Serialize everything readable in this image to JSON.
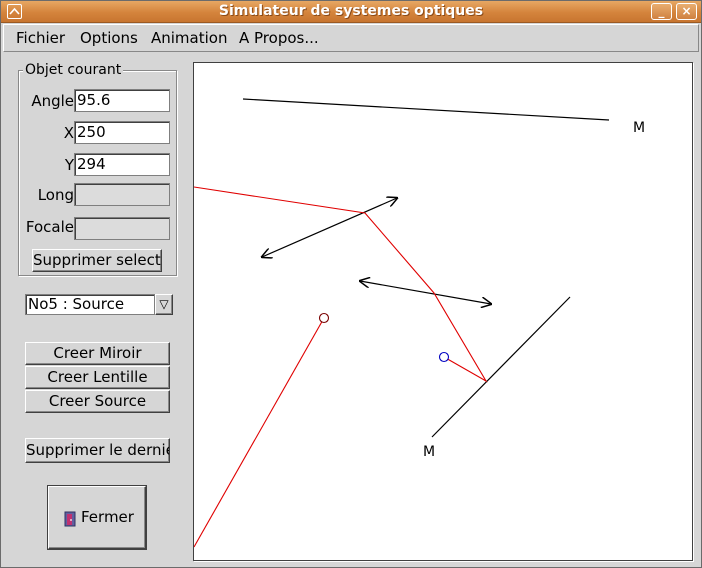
{
  "window": {
    "title": "Simulateur de systemes optiques",
    "minimize_glyph": "_",
    "close_glyph": "×"
  },
  "menu": {
    "items": [
      "Fichier",
      "Options",
      "Animation",
      "A Propos..."
    ]
  },
  "object_panel": {
    "group_label": "Objet courant",
    "fields": [
      {
        "label": "Angle",
        "value": "95.6",
        "enabled": true
      },
      {
        "label": "X",
        "value": "250",
        "enabled": true
      },
      {
        "label": "Y",
        "value": "294",
        "enabled": true
      },
      {
        "label": "Long",
        "value": "",
        "enabled": false
      },
      {
        "label": "Focale",
        "value": "",
        "enabled": false
      }
    ],
    "delete_selection_label": "Supprimer selection"
  },
  "object_select": {
    "selected": "No5 : Source",
    "arrow_icon": "chevron-down-icon"
  },
  "create_buttons": {
    "mirror": "Creer Miroir",
    "lens": "Creer Lentille",
    "source": "Creer Source"
  },
  "delete_last_label": "Supprimer le dernier objet",
  "close_button": {
    "label": "Fermer",
    "icon": "door-exit-icon"
  },
  "canvas": {
    "mirror_label": "M",
    "colors": {
      "ray": "#e00000",
      "element": "#000000",
      "source_marker": "#0000c0",
      "background": "#ffffff"
    }
  }
}
